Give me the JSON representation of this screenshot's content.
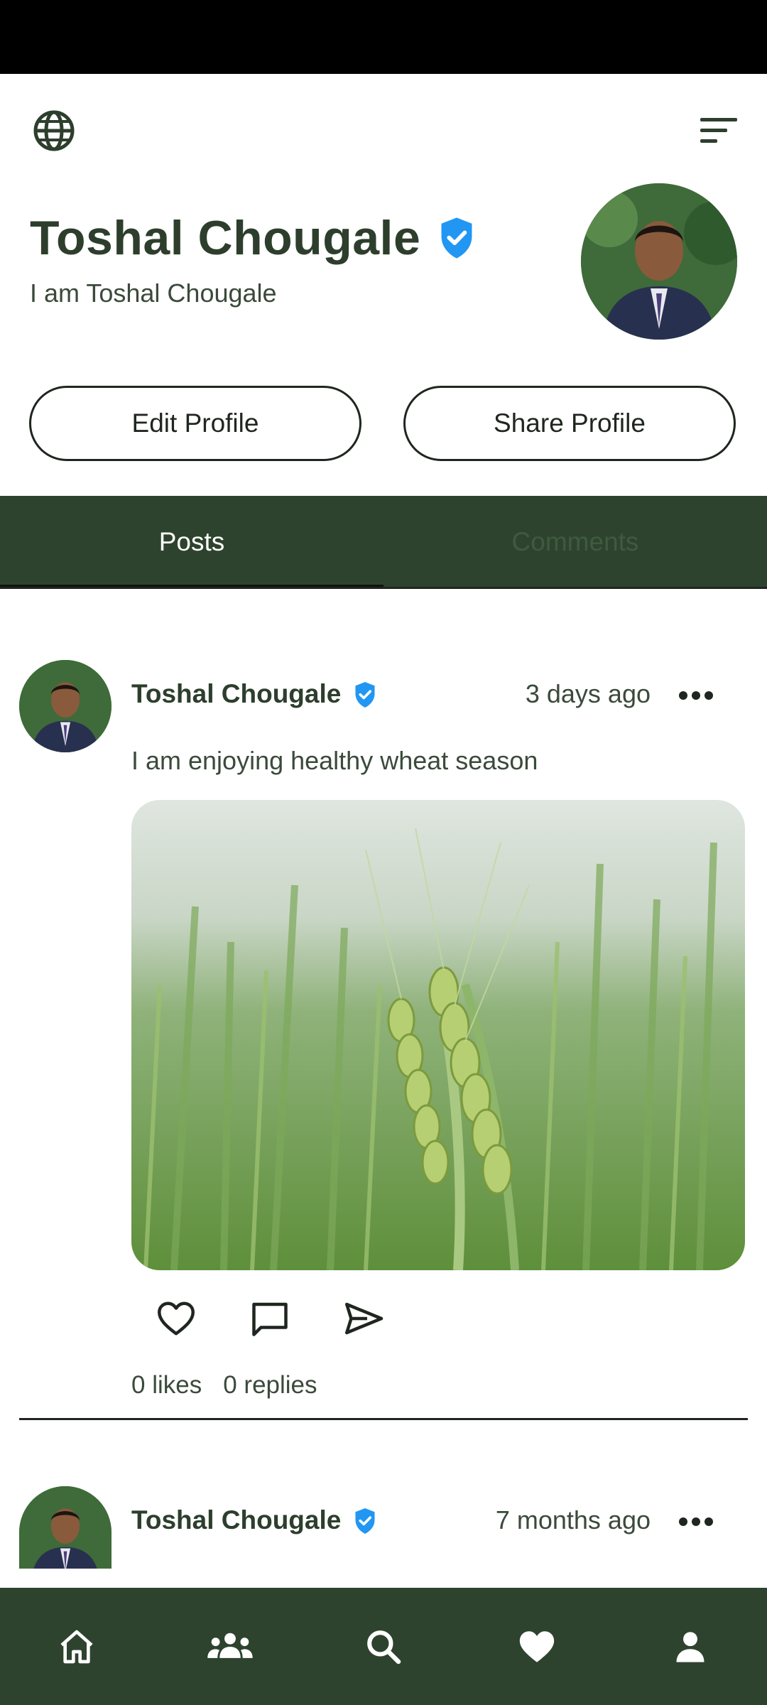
{
  "profile": {
    "name": "Toshal Chougale",
    "bio": "I am Toshal Chougale",
    "edit_label": "Edit Profile",
    "share_label": "Share Profile"
  },
  "tabs": [
    {
      "label": "Posts",
      "active": true
    },
    {
      "label": "Comments",
      "active": false
    }
  ],
  "posts": [
    {
      "author": "Toshal Chougale",
      "time": "3 days ago",
      "text": "I am enjoying healthy wheat season",
      "likes": "0 likes",
      "replies": "0 replies"
    },
    {
      "author": "Toshal Chougale",
      "time": "7 months ago"
    }
  ],
  "icons": {
    "top_left": "globe-icon",
    "top_right": "menu-icon",
    "nav": [
      "home-icon",
      "community-icon",
      "search-icon",
      "heart-icon",
      "profile-icon"
    ]
  },
  "colors": {
    "primary": "#2e432e",
    "verified": "#2196f3",
    "text": "#2d3e2d"
  }
}
